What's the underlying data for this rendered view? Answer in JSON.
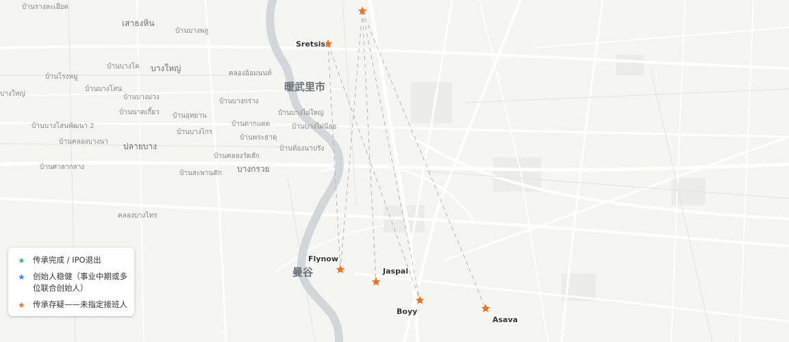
{
  "map": {
    "city_labels": [
      {
        "id": "nonthaburi",
        "text": "暖武里市"
      },
      {
        "id": "bangkok",
        "text": "曼谷"
      }
    ],
    "place_labels": [
      {
        "id": "p1",
        "text": "บ้านรางละเอียด"
      },
      {
        "id": "p2",
        "text": "เสาธงหิน"
      },
      {
        "id": "p3",
        "text": "บ้านบางพลู"
      },
      {
        "id": "p4",
        "text": "บ้านบางโค"
      },
      {
        "id": "p5",
        "text": "บางใหญ่"
      },
      {
        "id": "p6",
        "text": "บ้านโรงหมู"
      },
      {
        "id": "p7",
        "text": "บางใหญ่"
      },
      {
        "id": "p8",
        "text": "บ้านบางโสน"
      },
      {
        "id": "p9",
        "text": "บ้านบางม่วง"
      },
      {
        "id": "p10",
        "text": "บ้านนาดเกี้ยว"
      },
      {
        "id": "p11",
        "text": "บ้านบางโสนพัฒนา 2"
      },
      {
        "id": "p12",
        "text": "บ้านคลองบางนา"
      },
      {
        "id": "p13",
        "text": "ปลายบาง"
      },
      {
        "id": "p14",
        "text": "บ้านศาลากลาง"
      },
      {
        "id": "p15",
        "text": "บ้านบางกร่าง"
      },
      {
        "id": "p16",
        "text": "บ้านอุทยาน"
      },
      {
        "id": "p17",
        "text": "บ้านบางไกร"
      },
      {
        "id": "p18",
        "text": "บ้านตากแดด"
      },
      {
        "id": "p19",
        "text": "บ้านพระธาตุ"
      },
      {
        "id": "p20",
        "text": "บ้านคลองวัดสัก"
      },
      {
        "id": "p21",
        "text": "บ้านสะพานตัก"
      },
      {
        "id": "p22",
        "text": "บางกรวย"
      },
      {
        "id": "p23",
        "text": "บ้านบางไผ่ใหญ่"
      },
      {
        "id": "p24",
        "text": "บ้านบางไผ่น้อย"
      },
      {
        "id": "p25",
        "text": "บ้านท้องนาปรัง"
      },
      {
        "id": "p26",
        "text": "คลองอ้อมนนท์"
      },
      {
        "id": "p27",
        "text": "คลองบางไทร"
      }
    ],
    "markers": [
      {
        "id": "top",
        "label": "",
        "category": "uncertain"
      },
      {
        "id": "sretsis",
        "label": "Sretsis",
        "category": "uncertain"
      },
      {
        "id": "flynow",
        "label": "Flynow",
        "category": "uncertain"
      },
      {
        "id": "jaspal",
        "label": "Jaspal",
        "category": "uncertain"
      },
      {
        "id": "boyy",
        "label": "Boyy",
        "category": "uncertain"
      },
      {
        "id": "asava",
        "label": "Asava",
        "category": "uncertain"
      }
    ]
  },
  "legend": {
    "items": [
      {
        "label": "传承完成 / IPO退出",
        "icon": "star-icon",
        "color": "#2bb5a6"
      },
      {
        "label": "创始人稳健（事业中期或多位联合创始人）",
        "icon": "star-icon",
        "color": "#3b82f6"
      },
      {
        "label": "传承存疑——未指定接班人",
        "icon": "star-icon",
        "color": "#f2711c"
      }
    ]
  },
  "colors": {
    "map_background": "#f5f5f4",
    "river": "#d3d7da",
    "road": "#ffffff",
    "marker_uncertain": "#f2711c",
    "connector": "#b5b5b5"
  }
}
